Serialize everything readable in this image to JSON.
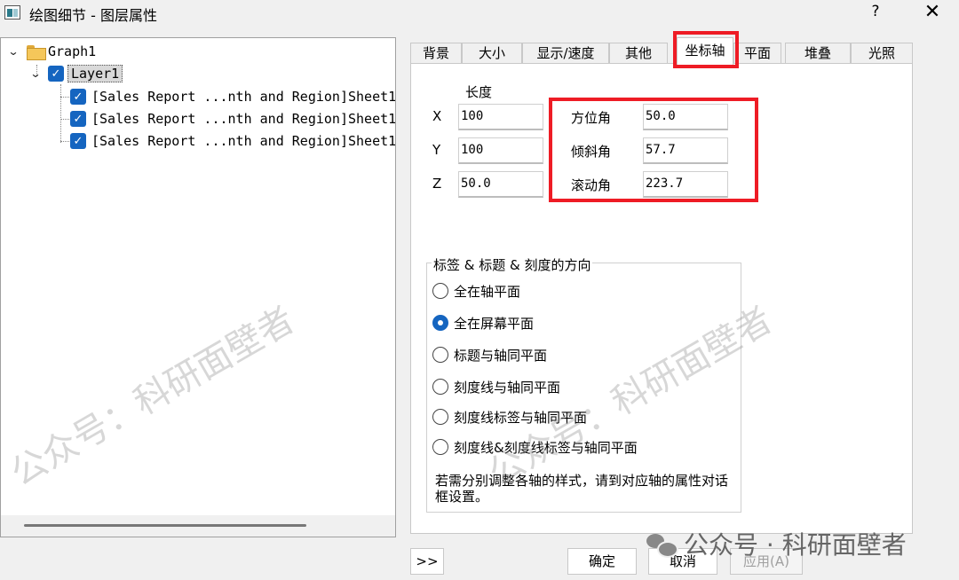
{
  "window": {
    "title": "绘图细节 - 图层属性",
    "help": "?",
    "close": "✕"
  },
  "tree": {
    "graph": "Graph1",
    "layer": "Layer1",
    "items": [
      "[Sales Report ...nth and Region]Sheet1! ",
      "[Sales Report ...nth and Region]Sheet1! ",
      "[Sales Report ...nth and Region]Sheet1! "
    ]
  },
  "tabs": [
    "背景",
    "大小",
    "显示/速度",
    "其他",
    "坐标轴",
    "平面",
    "堆叠",
    "光照"
  ],
  "active_tab": "坐标轴",
  "length": {
    "heading": "长度",
    "x_label": "X",
    "x_value": "100",
    "y_label": "Y",
    "y_value": "100",
    "z_label": "Z",
    "z_value": "50.0"
  },
  "angles": {
    "azimuth_label": "方位角",
    "azimuth_value": "50.0",
    "tilt_label": "倾斜角",
    "tilt_value": "57.7",
    "roll_label": "滚动角",
    "roll_value": "223.7"
  },
  "orientation": {
    "title": "标签 & 标题 & 刻度的方向",
    "options": [
      "全在轴平面",
      "全在屏幕平面",
      "标题与轴同平面",
      "刻度线与轴同平面",
      "刻度线标签与轴同平面",
      "刻度线&刻度线标签与轴同平面"
    ],
    "selected": "全在屏幕平面",
    "note": "若需分别调整各轴的样式，请到对应轴的属性对话框设置。"
  },
  "buttons": {
    "expand": ">>",
    "ok": "确定",
    "cancel": "取消",
    "apply": "应用(A)"
  },
  "watermark": {
    "diag": "公众号：科研面壁者",
    "footer": "公众号 · 科研面壁者"
  }
}
